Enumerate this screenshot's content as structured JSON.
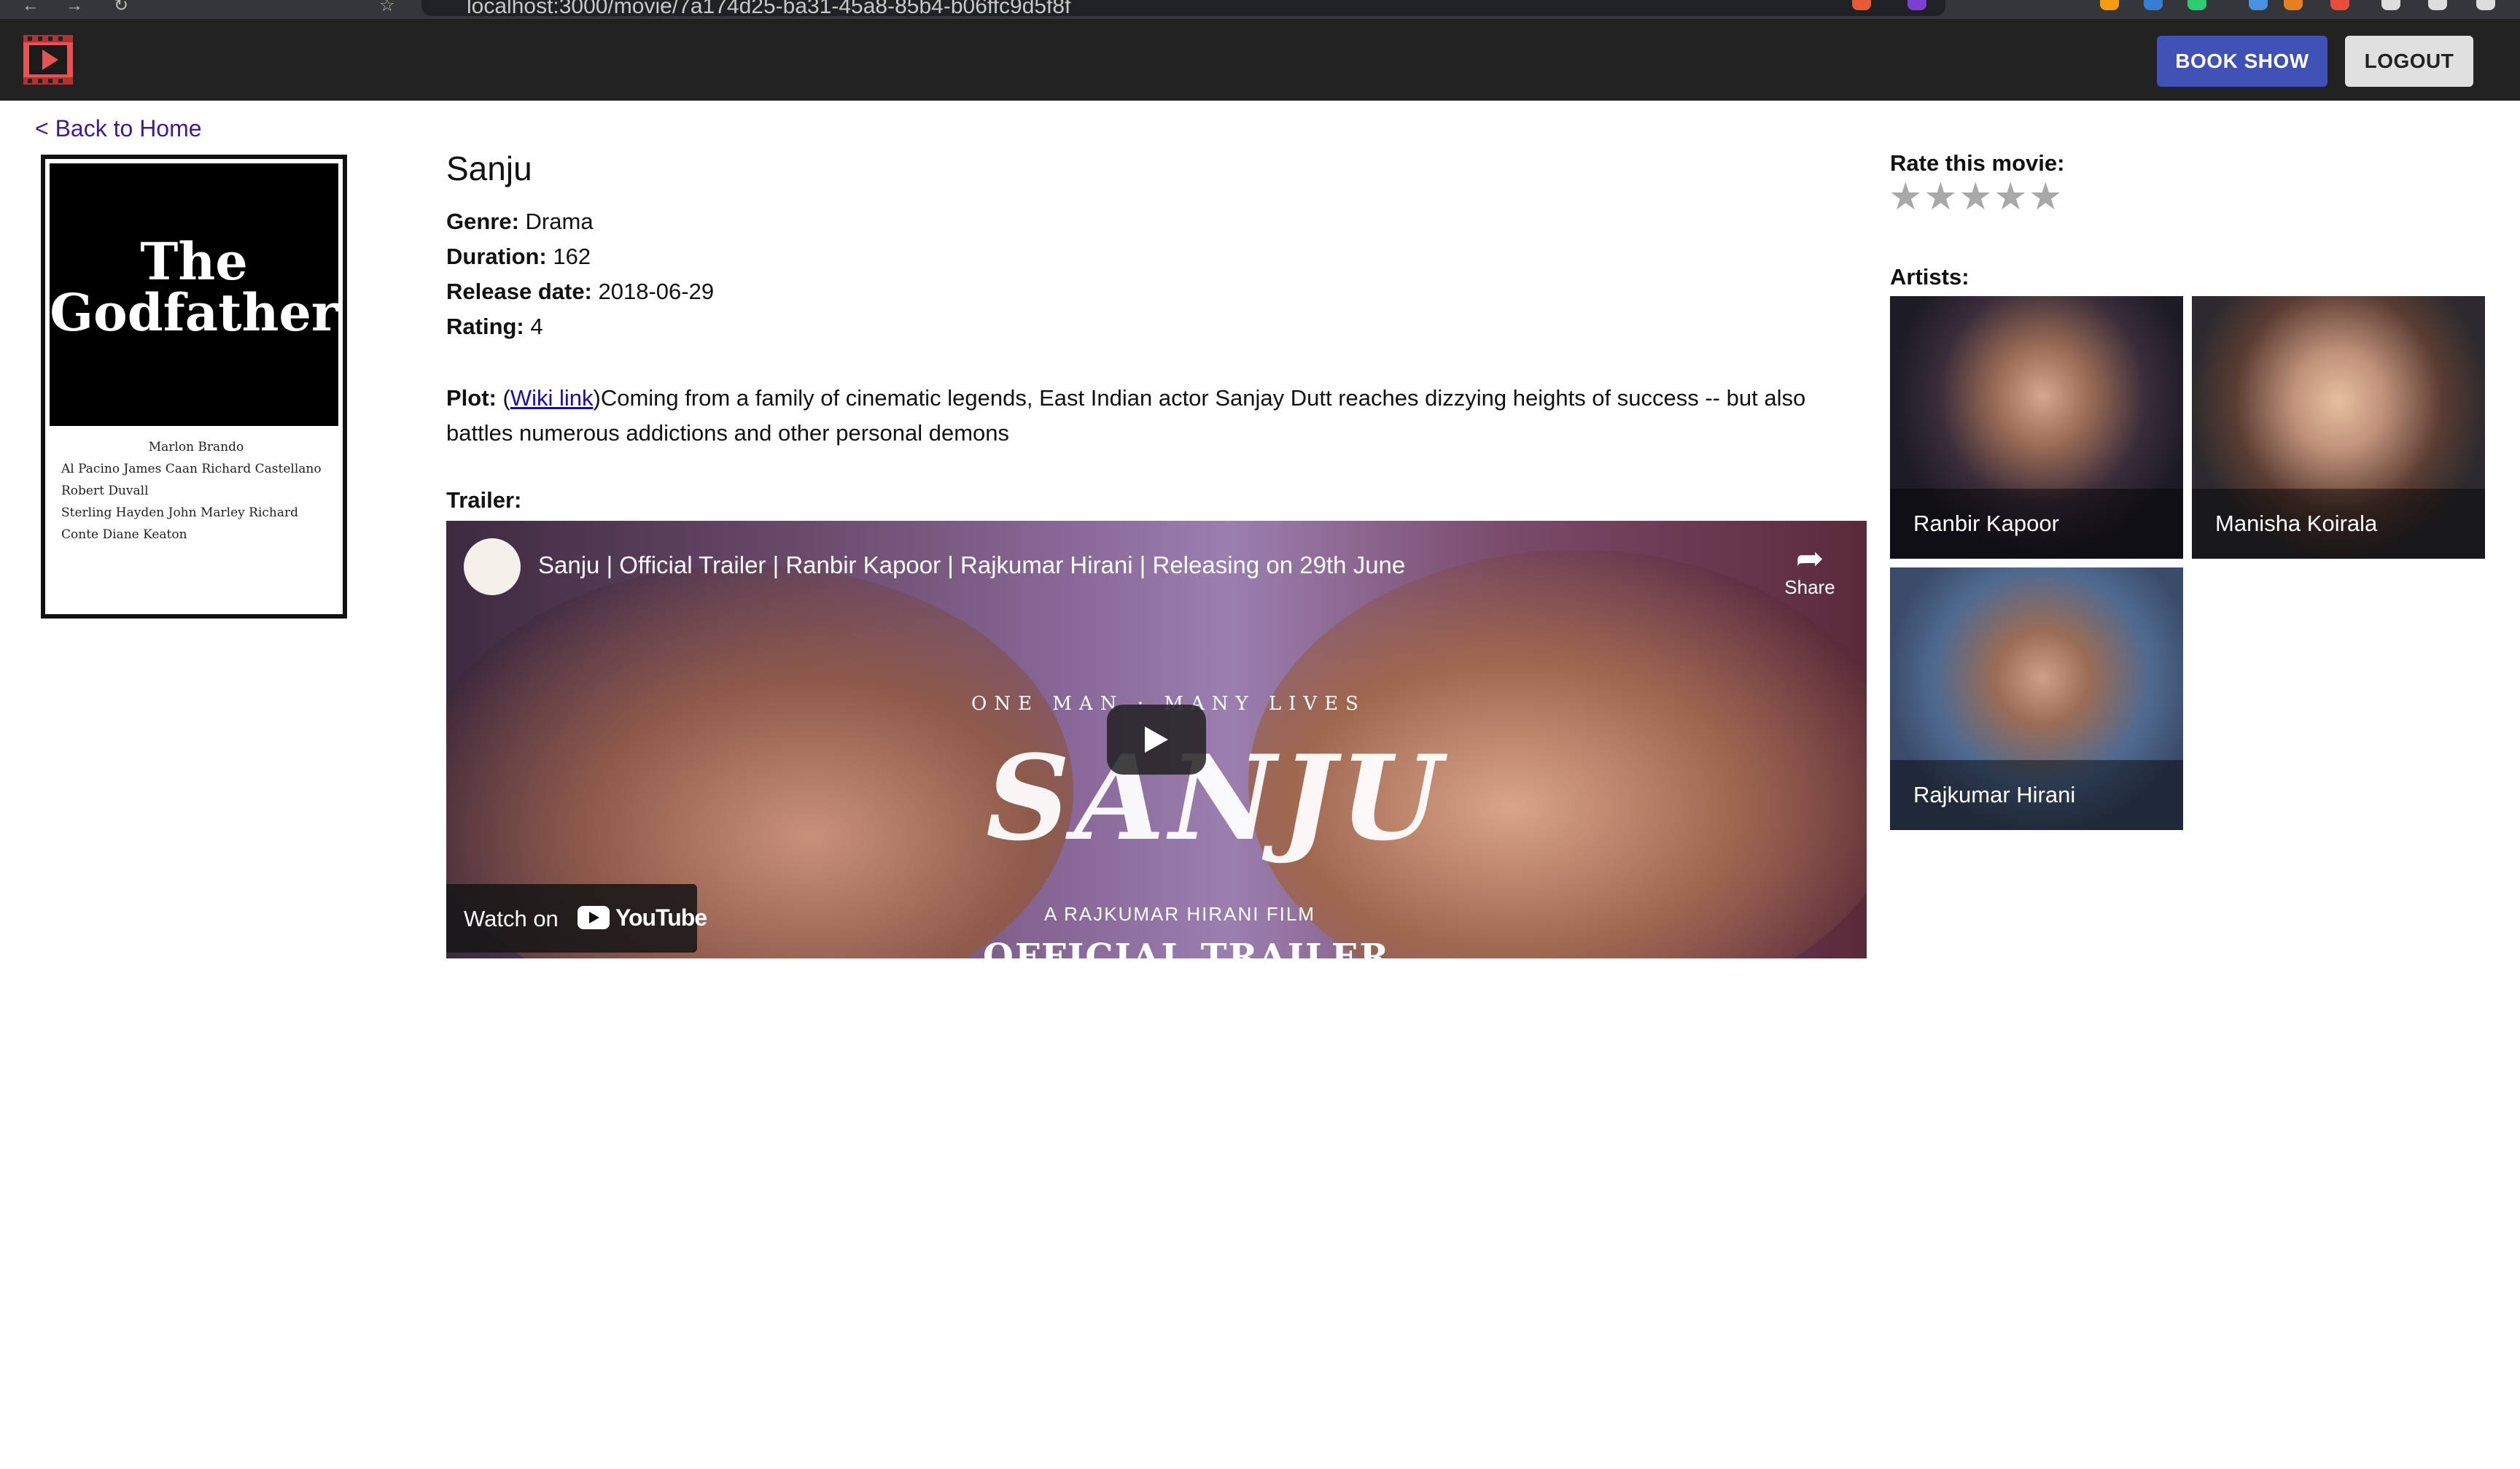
{
  "browser": {
    "url": "localhost:3000/movie/7a174d25-ba31-45a8-85b4-b06ffc9d5f8f"
  },
  "header": {
    "book_show_label": "BOOK SHOW",
    "logout_label": "LOGOUT"
  },
  "nav": {
    "back_label": "< Back to Home"
  },
  "poster": {
    "title": "The Godfather",
    "credits": [
      "Marlon Brando",
      "Al Pacino   James Caan   Richard Castellano   Robert Duvall",
      "Sterling Hayden   John Marley   Richard Conte   Diane Keaton"
    ]
  },
  "movie": {
    "title": "Sanju",
    "genre_label": "Genre:",
    "genre": "Drama",
    "duration_label": "Duration:",
    "duration": "162",
    "release_label": "Release date:",
    "release_date": "2018-06-29",
    "rating_label": "Rating:",
    "rating": "4",
    "plot_label": "Plot:",
    "wiki_link": "Wiki link",
    "plot": "Coming from a family of cinematic legends, East Indian actor Sanjay Dutt reaches dizzying heights of success -- but also battles numerous addictions and other personal demons",
    "trailer_label": "Trailer:"
  },
  "trailer": {
    "title": "Sanju | Official Trailer | Ranbir Kapoor | Rajkumar Hirani | Releasing on 29th June",
    "share_label": "Share",
    "tagline": "ONE MAN · MANY LIVES",
    "big_title": "SANJU",
    "director_credit": "A RAJKUMAR HIRANI FILM",
    "overlay": "OFFICIAL TRAILER",
    "watch_on": "Watch on",
    "youtube": "YouTube"
  },
  "rating_widget": {
    "label": "Rate this movie:",
    "stars_total": 5,
    "stars_filled": 0
  },
  "artists": {
    "label": "Artists:",
    "items": [
      {
        "name": "Ranbir Kapoor"
      },
      {
        "name": "Manisha Koirala"
      },
      {
        "name": "Rajkumar Hirani"
      }
    ]
  },
  "colors": {
    "header_bg": "#212121",
    "book_button": "#3f51b5",
    "logout_button": "#e0e0e0",
    "link": "#1a0dab",
    "back_link": "#3f1b8f",
    "star_empty": "#a8a8a8"
  }
}
